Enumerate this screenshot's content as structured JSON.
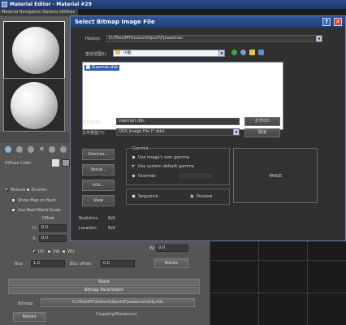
{
  "material_editor": {
    "title": "Material Editor - Material #29",
    "menu": "Material  Navigation  Options  Utilities",
    "diffuse_label": "Diffuse Color:",
    "coords": {
      "texture_radio": "Texture",
      "environ_radio": "Environ",
      "show_map_label": "Show Map on Back",
      "real_world_label": "Use Real-World Scale",
      "offset_label": "Offset",
      "u_value": "0.0",
      "v_value": "0.0",
      "w_value": "0.0",
      "uv": "UV",
      "vw": "VW",
      "wu": "WU",
      "blur_label": "Blur:",
      "blur_value": "1.0",
      "blur_offset_label": "Blur offset:",
      "blur_offset_value": "0.0",
      "rotate_label": "Rotate"
    },
    "noise_label": "Noise",
    "bitmap_params_label": "Bitmap Parameters",
    "bitmap_label": "Bitmap:",
    "bitmap_path": "D:\\Files\\MY\\texture\\tiputt\\Fjsaaeman\\bdy.dds",
    "reload_label": "Reload",
    "cropping_label": "Cropping/Placement"
  },
  "dialog": {
    "title": "Select Bitmap Image File",
    "help_icon": "?",
    "close_icon": "✕",
    "history_label": "History:",
    "history_value": "D:\\Files\\MY\\texture\\tiputt\\Fjsaaeman",
    "lookin_label": "查找范围(I):",
    "lookin_value": "小图",
    "file_item": "Siaeman.dds",
    "filename_label": "文件名(N):",
    "filename_value": "siaeman.dds",
    "filetype_label": "文件类型(T):",
    "filetype_value": "DDS Image File (*.dds)",
    "open_label": "打开(O)",
    "cancel_label": "取消",
    "devices_label": "Devices...",
    "setup_label": "Setup...",
    "info_label": "Info...",
    "view_label": "View",
    "gamma": {
      "title": "Gamma",
      "use_own": "Use image's own gamma",
      "use_default": "Use system default gamma",
      "override": "Override",
      "override_value": "",
      "selected": "use_default"
    },
    "sequence_label": "Sequence",
    "preview_label": "Preview",
    "preview_checked": true,
    "preview_image_label": "IMAGE",
    "statistics_label": "Statistics:",
    "statistics_value": "N/A",
    "location_label": "Location:",
    "location_value": "N/A"
  },
  "colors": {
    "title_bar": "#2f5597",
    "close_button": "#c8452f",
    "dialog_bg": "#303030",
    "panel_bg": "#555555"
  }
}
